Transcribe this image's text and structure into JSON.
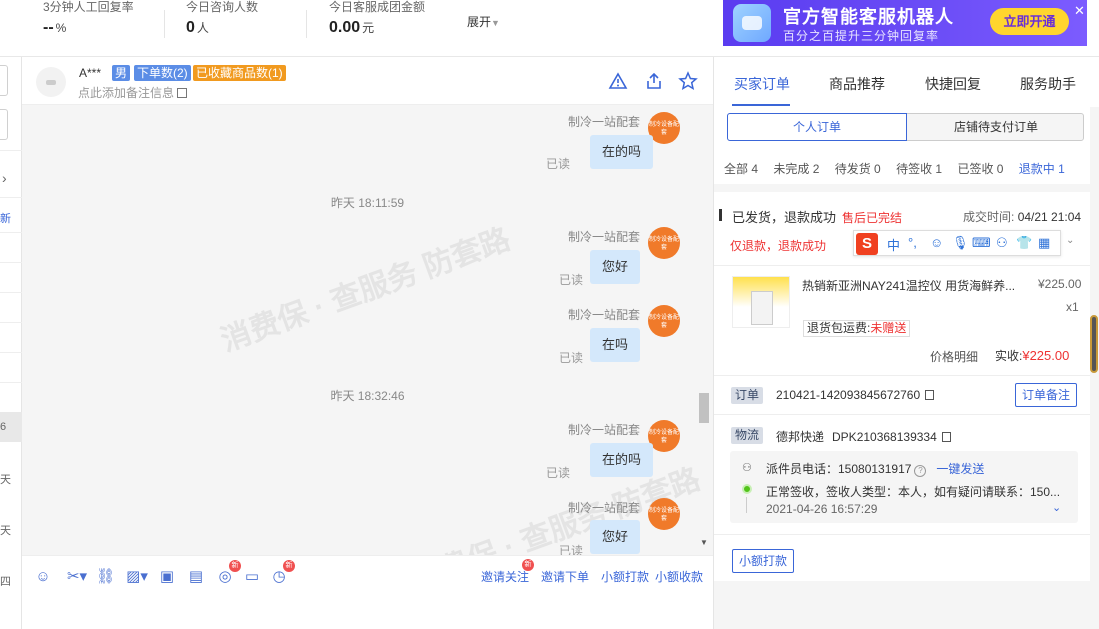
{
  "topbar": {
    "stats": [
      {
        "label": "3分钟人工回复率",
        "value": "--",
        "unit": "%"
      },
      {
        "label": "今日咨询人数",
        "value": "0",
        "unit": "人"
      },
      {
        "label": "今日客服成团金额",
        "value": "0.00",
        "unit": "元"
      }
    ],
    "expand_label": "展开",
    "banner": {
      "title": "官方智能客服机器人",
      "subtitle": "百分之百提升三分钟回复率",
      "button": "立即开通",
      "close": "✕"
    }
  },
  "left": {
    "fragments": [
      "新",
      "6",
      "天",
      "天",
      "四"
    ]
  },
  "chat": {
    "user_name": "A***",
    "tags": [
      "男",
      "下单数(2)",
      "已收藏商品数(1)"
    ],
    "note_placeholder": "点此添加备注信息",
    "messages": [
      {
        "sender": "制冷一站配套",
        "text": "在的吗",
        "status": "已读"
      },
      {
        "time": "昨天 18:11:59"
      },
      {
        "sender": "制冷一站配套",
        "text": "您好",
        "status": "已读"
      },
      {
        "sender": "制冷一站配套",
        "text": "在吗",
        "status": "已读"
      },
      {
        "time": "昨天 18:32:46"
      },
      {
        "sender": "制冷一站配套",
        "text": "在的吗",
        "status": "已读"
      },
      {
        "sender": "制冷一站配套",
        "text": "您好",
        "status": "已读"
      }
    ],
    "avatar_text": "制冷设备配套",
    "watermark": "消费保 · 查服务 防套路"
  },
  "toolbar": {
    "new_badge": "新",
    "links": [
      "邀请关注",
      "邀请下单",
      "小额打款",
      "小额收款"
    ]
  },
  "right": {
    "tabs": [
      "买家订单",
      "商品推荐",
      "快捷回复",
      "服务助手"
    ],
    "segments": [
      "个人订单",
      "店铺待支付订单"
    ],
    "filters": [
      "全部 4",
      "未完成 2",
      "待发货 0",
      "待签收 1",
      "已签收 0",
      "退款中 1"
    ],
    "order": {
      "status": "已发货，退款成功",
      "after_sale": "售后已完结",
      "time_label": "成交时间:",
      "time": "04/21 21:04",
      "refund": "仅退款，退款成功",
      "product_title": "热销新亚洲NAY241温控仪 用货海鲜养...",
      "price": "¥225.00",
      "qty": "x1",
      "return_label": "退货包运费:",
      "return_value": "未赠送",
      "price_detail": "价格明细",
      "paid_label": "实收:",
      "paid": "¥225.00",
      "order_chip": "订单",
      "order_no": "210421-142093845672760",
      "note_button": "订单备注",
      "logistics_chip": "物流",
      "carrier": "德邦快递",
      "tracking_no": "DPK210368139334",
      "courier_phone": "派件员电话：15080131917",
      "quick_send": "一键发送",
      "track_text": "正常签收，签收人类型：本人，如有疑问请联系：150...",
      "track_time": "2021-04-26 16:57:29",
      "pay_button": "小额打款"
    }
  }
}
